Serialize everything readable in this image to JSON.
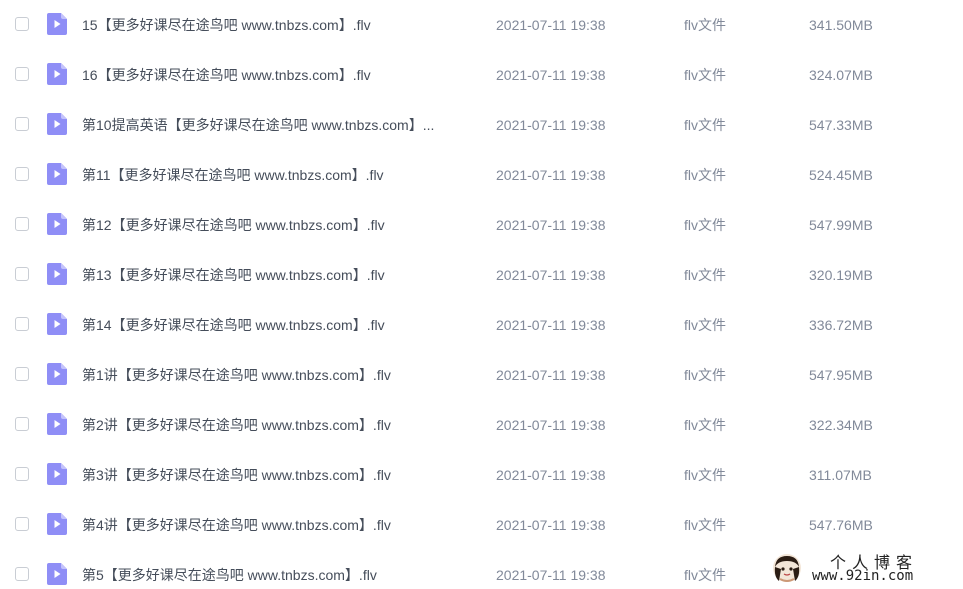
{
  "files": [
    {
      "name": "15【更多好课尽在途鸟吧 www.tnbzs.com】.flv",
      "date": "2021-07-11 19:38",
      "type": "flv文件",
      "size": "341.50MB",
      "icon": "video-file-icon"
    },
    {
      "name": "16【更多好课尽在途鸟吧 www.tnbzs.com】.flv",
      "date": "2021-07-11 19:38",
      "type": "flv文件",
      "size": "324.07MB",
      "icon": "video-file-icon"
    },
    {
      "name": "第10提高英语【更多好课尽在途鸟吧 www.tnbzs.com】...",
      "date": "2021-07-11 19:38",
      "type": "flv文件",
      "size": "547.33MB",
      "icon": "video-file-icon"
    },
    {
      "name": "第11【更多好课尽在途鸟吧 www.tnbzs.com】.flv",
      "date": "2021-07-11 19:38",
      "type": "flv文件",
      "size": "524.45MB",
      "icon": "video-file-icon"
    },
    {
      "name": "第12【更多好课尽在途鸟吧 www.tnbzs.com】.flv",
      "date": "2021-07-11 19:38",
      "type": "flv文件",
      "size": "547.99MB",
      "icon": "video-file-icon"
    },
    {
      "name": "第13【更多好课尽在途鸟吧 www.tnbzs.com】.flv",
      "date": "2021-07-11 19:38",
      "type": "flv文件",
      "size": "320.19MB",
      "icon": "video-file-icon"
    },
    {
      "name": "第14【更多好课尽在途鸟吧 www.tnbzs.com】.flv",
      "date": "2021-07-11 19:38",
      "type": "flv文件",
      "size": "336.72MB",
      "icon": "video-file-icon"
    },
    {
      "name": "第1讲【更多好课尽在途鸟吧 www.tnbzs.com】.flv",
      "date": "2021-07-11 19:38",
      "type": "flv文件",
      "size": "547.95MB",
      "icon": "video-file-icon"
    },
    {
      "name": "第2讲【更多好课尽在途鸟吧 www.tnbzs.com】.flv",
      "date": "2021-07-11 19:38",
      "type": "flv文件",
      "size": "322.34MB",
      "icon": "video-file-icon"
    },
    {
      "name": "第3讲【更多好课尽在途鸟吧 www.tnbzs.com】.flv",
      "date": "2021-07-11 19:38",
      "type": "flv文件",
      "size": "311.07MB",
      "icon": "video-file-icon"
    },
    {
      "name": "第4讲【更多好课尽在途鸟吧 www.tnbzs.com】.flv",
      "date": "2021-07-11 19:38",
      "type": "flv文件",
      "size": "547.76MB",
      "icon": "video-file-icon"
    },
    {
      "name": "第5【更多好课尽在途鸟吧 www.tnbzs.com】.flv",
      "date": "2021-07-11 19:38",
      "type": "flv文件",
      "size": "",
      "icon": "video-file-icon"
    }
  ],
  "watermark": {
    "title": "个人博客",
    "url": "www.92in.com",
    "icon": "avatar-icon"
  },
  "colors": {
    "icon_fill": "#8f8ef6",
    "icon_fold": "#c3c2fb",
    "name_text": "#454d5a",
    "meta_text": "#818999",
    "checkbox_border": "#c9cdd4"
  }
}
